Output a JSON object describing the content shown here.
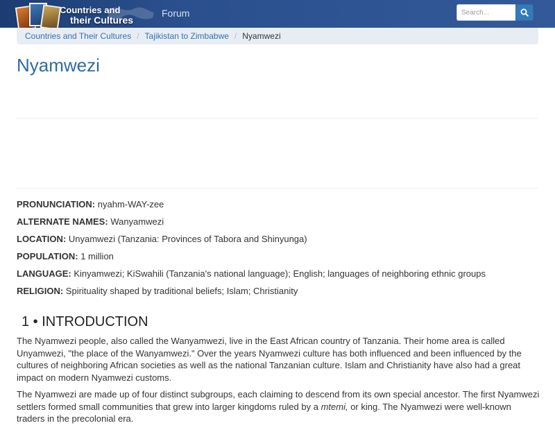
{
  "navbar": {
    "brand_line1": "Countries and",
    "brand_line2": "their Cultures",
    "forum_link": "Forum",
    "search_placeholder": "Search...",
    "search_icon": "search-icon",
    "background_color": "#2a4f8c"
  },
  "breadcrumb": {
    "items": [
      "Countries and Their Cultures",
      "Tajikistan to Zimbabwe",
      "Nyamwezi"
    ]
  },
  "page": {
    "title": "Nyamwezi",
    "accent_color": "#2d6ba3"
  },
  "facts": [
    {
      "label": "PRONUNCIATION:",
      "value": "nyahm-WAY-zee"
    },
    {
      "label": "ALTERNATE NAMES:",
      "value": "Wanyamwezi"
    },
    {
      "label": "LOCATION:",
      "value": "Unyamwezi (Tanzania: Provinces of Tabora and Shinyunga)"
    },
    {
      "label": "POPULATION:",
      "value": "1 million"
    },
    {
      "label": "LANGUAGE:",
      "value": "Kinyamwezi; KiSwahili (Tanzania's national language); English; languages of neighboring ethnic groups"
    },
    {
      "label": "RELIGION:",
      "value": "Spirituality shaped by traditional beliefs; Islam; Christianity"
    }
  ],
  "section": {
    "heading": "1 • INTRODUCTION",
    "paragraph1": "The Nyamwezi people, also called the Wanyamwezi, live in the East African country of Tanzania. Their home area is called Unyamwezi, \"the place of the Wanyamwezi.\" Over the years Nyamwezi culture has both influenced and been influenced by the cultures of neighboring African societies as well as the national Tanzanian culture. Islam and Christianity have also had a great impact on modern Nyamwezi customs.",
    "paragraph2_before": "The Nyamwezi are made up of four distinct subgroups, each claiming to descend from its own special ancestor. The first Nyamwezi settlers formed small communities that grew into larger kingdoms ruled by a ",
    "paragraph2_em": "mtemi,",
    "paragraph2_after": " or king. The Nyamwezi were well-known traders in the precolonial era."
  }
}
